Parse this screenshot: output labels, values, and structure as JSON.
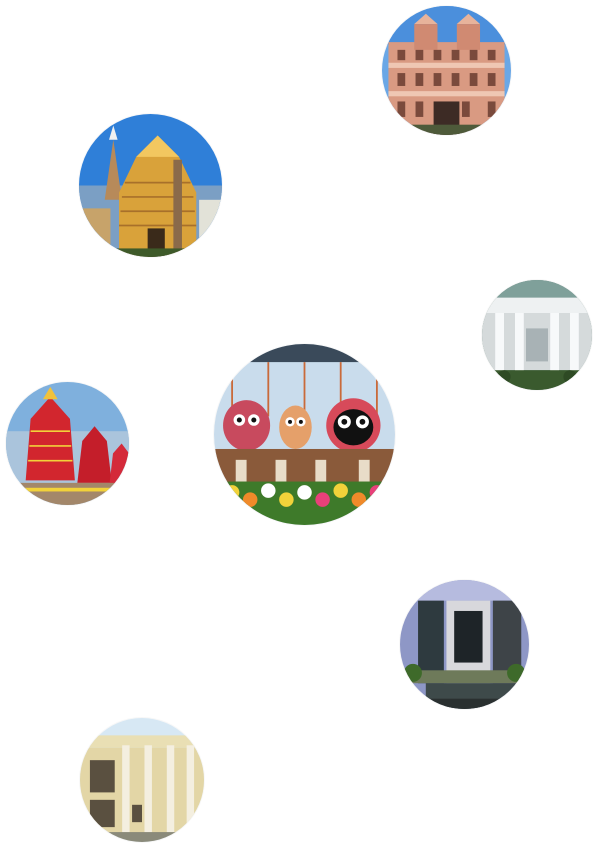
{
  "photos": [
    {
      "id": "palace",
      "subject": "pink-heritage-building-photo",
      "sky": "#5d9fe0",
      "accent": "#d9947c"
    },
    {
      "id": "temple",
      "subject": "golden-temple-photo",
      "sky": "#2f7fd8",
      "accent": "#d9a23a"
    },
    {
      "id": "portico",
      "subject": "white-portico-night-photo",
      "sky": "#7fa09a",
      "accent": "#e9eef0"
    },
    {
      "id": "deities",
      "subject": "jagannath-deities-photo",
      "sky": "#b9d3ea",
      "accent": "#d84f64"
    },
    {
      "id": "chariots",
      "subject": "rath-yatra-chariots-photo",
      "sky": "#6ea6d9",
      "accent": "#d2262e"
    },
    {
      "id": "interior",
      "subject": "modern-interior-photo",
      "sky": "#8e97c6",
      "accent": "#2e3a3f"
    },
    {
      "id": "building",
      "subject": "colonnade-building-photo",
      "sky": "#cfe4f2",
      "accent": "#e8dcaf"
    }
  ]
}
